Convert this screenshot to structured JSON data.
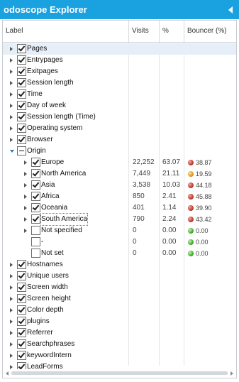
{
  "window": {
    "title": "odoscope Explorer",
    "collapse_icon": "triangle-left-icon"
  },
  "table": {
    "columns": [
      "Label",
      "Visits",
      "%",
      "Bouncer (%)"
    ],
    "rows": [
      {
        "label": "Pages",
        "level": 0,
        "state": "collapsed",
        "check": "checked",
        "selected": true
      },
      {
        "label": "Entrypages",
        "level": 0,
        "state": "collapsed",
        "check": "checked"
      },
      {
        "label": "Exitpages",
        "level": 0,
        "state": "collapsed",
        "check": "checked"
      },
      {
        "label": "Session length",
        "level": 0,
        "state": "collapsed",
        "check": "checked"
      },
      {
        "label": "Time",
        "level": 0,
        "state": "collapsed",
        "check": "checked"
      },
      {
        "label": "Day of week",
        "level": 0,
        "state": "collapsed",
        "check": "checked"
      },
      {
        "label": "Session length (Time)",
        "level": 0,
        "state": "collapsed",
        "check": "checked"
      },
      {
        "label": "Operating system",
        "level": 0,
        "state": "collapsed",
        "check": "checked"
      },
      {
        "label": "Browser",
        "level": 0,
        "state": "collapsed",
        "check": "checked"
      },
      {
        "label": "Origin",
        "level": 0,
        "state": "expanded",
        "check": "partial"
      },
      {
        "label": "Europe",
        "level": 1,
        "state": "collapsed",
        "check": "checked",
        "visits": "22,252",
        "pct": "63.07",
        "bouncer": "38.87",
        "dot": "red"
      },
      {
        "label": "North America",
        "level": 1,
        "state": "collapsed",
        "check": "checked",
        "visits": "7,449",
        "pct": "21.11",
        "bouncer": "19.59",
        "dot": "orange"
      },
      {
        "label": "Asia",
        "level": 1,
        "state": "collapsed",
        "check": "checked",
        "visits": "3,538",
        "pct": "10.03",
        "bouncer": "44.18",
        "dot": "red"
      },
      {
        "label": "Africa",
        "level": 1,
        "state": "collapsed",
        "check": "checked",
        "visits": "850",
        "pct": "2.41",
        "bouncer": "45.88",
        "dot": "red"
      },
      {
        "label": "Oceania",
        "level": 1,
        "state": "collapsed",
        "check": "checked",
        "visits": "401",
        "pct": "1.14",
        "bouncer": "39.90",
        "dot": "red"
      },
      {
        "label": "South America",
        "level": 1,
        "state": "collapsed",
        "check": "checked",
        "visits": "790",
        "pct": "2.24",
        "bouncer": "43.42",
        "dot": "red",
        "focus": true
      },
      {
        "label": "Not specified",
        "level": 1,
        "state": "collapsed",
        "check": "unchecked",
        "visits": "0",
        "pct": "0.00",
        "bouncer": "0.00",
        "dot": "green"
      },
      {
        "label": "-",
        "level": 1,
        "state": "none",
        "check": "unchecked",
        "visits": "0",
        "pct": "0.00",
        "bouncer": "0.00",
        "dot": "green"
      },
      {
        "label": "Not set",
        "level": 1,
        "state": "none",
        "check": "unchecked",
        "visits": "0",
        "pct": "0.00",
        "bouncer": "0.00",
        "dot": "green"
      },
      {
        "label": "Hostnames",
        "level": 0,
        "state": "collapsed",
        "check": "checked"
      },
      {
        "label": "Unique users",
        "level": 0,
        "state": "collapsed",
        "check": "checked"
      },
      {
        "label": "Screen width",
        "level": 0,
        "state": "collapsed",
        "check": "checked"
      },
      {
        "label": "Screen height",
        "level": 0,
        "state": "collapsed",
        "check": "checked"
      },
      {
        "label": "Color depth",
        "level": 0,
        "state": "collapsed",
        "check": "checked"
      },
      {
        "label": "plugins",
        "level": 0,
        "state": "collapsed",
        "check": "checked"
      },
      {
        "label": "Referrer",
        "level": 0,
        "state": "collapsed",
        "check": "checked"
      },
      {
        "label": "Searchphrases",
        "level": 0,
        "state": "collapsed",
        "check": "checked"
      },
      {
        "label": "keywordIntern",
        "level": 0,
        "state": "collapsed",
        "check": "checked"
      },
      {
        "label": "LeadForms",
        "level": 0,
        "state": "collapsed",
        "check": "checked"
      }
    ]
  },
  "colors": {
    "titlebar": "#1aa1df",
    "bouncer_high": "#c0392b",
    "bouncer_mid": "#e39a1b",
    "bouncer_low": "#3fae2a"
  }
}
